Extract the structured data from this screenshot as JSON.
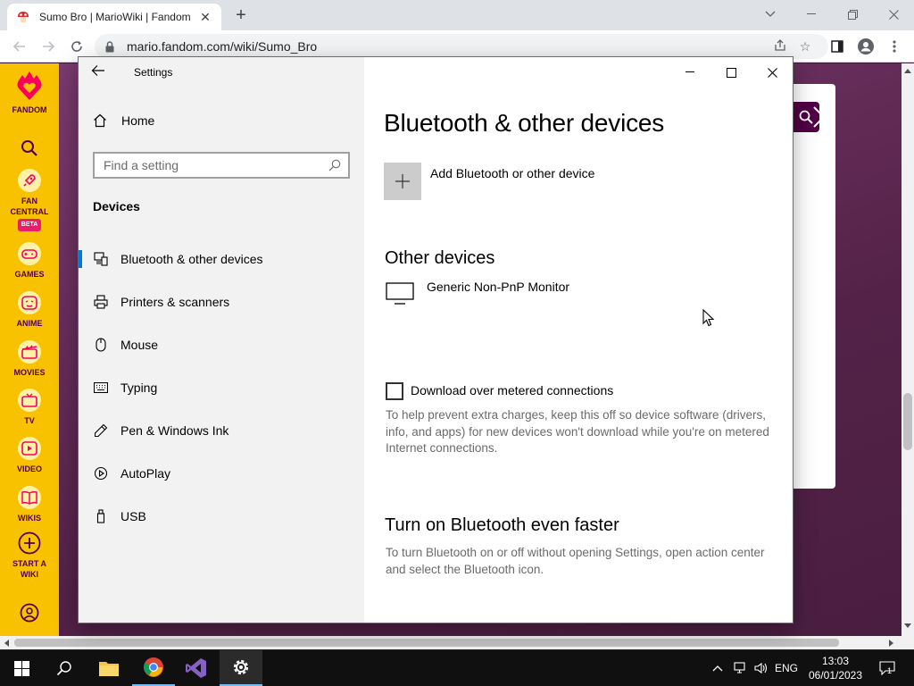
{
  "browser": {
    "tab_title": "Sumo Bro | MarioWiki | Fandom",
    "url": "mario.fandom.com/wiki/Sumo_Bro"
  },
  "fandom_rail": {
    "logo_label": "FANDOM",
    "items": [
      {
        "label_line1": "FAN",
        "label_line2": "CENTRAL",
        "badge": "BETA",
        "icon": "rocket-icon"
      },
      {
        "label_line1": "GAMES",
        "icon": "controller-icon"
      },
      {
        "label_line1": "ANIME",
        "icon": "anime-face-icon"
      },
      {
        "label_line1": "MOVIES",
        "icon": "clapperboard-icon"
      },
      {
        "label_line1": "TV",
        "icon": "tv-icon"
      },
      {
        "label_line1": "VIDEO",
        "icon": "play-icon"
      },
      {
        "label_line1": "WIKIS",
        "icon": "book-icon"
      },
      {
        "label_line1": "START A",
        "label_line2": "WIKI",
        "icon": "plus-circle-icon"
      }
    ]
  },
  "settings": {
    "app_title": "Settings",
    "home_label": "Home",
    "search_placeholder": "Find a setting",
    "section_label": "Devices",
    "nav": [
      {
        "label": "Bluetooth & other devices",
        "icon": "bluetooth-devices-icon",
        "active": true
      },
      {
        "label": "Printers & scanners",
        "icon": "printer-icon"
      },
      {
        "label": "Mouse",
        "icon": "mouse-icon"
      },
      {
        "label": "Typing",
        "icon": "keyboard-icon"
      },
      {
        "label": "Pen & Windows Ink",
        "icon": "pen-icon"
      },
      {
        "label": "AutoPlay",
        "icon": "autoplay-icon"
      },
      {
        "label": "USB",
        "icon": "usb-icon"
      }
    ],
    "page_title": "Bluetooth & other devices",
    "add_device_label": "Add Bluetooth or other device",
    "other_devices_heading": "Other devices",
    "device_name": "Generic Non-PnP Monitor",
    "metered_label": "Download over metered connections",
    "metered_checked": false,
    "metered_help": "To help prevent extra charges, keep this off so device software (drivers, info, and apps) for new devices won't download while you're on metered Internet connections.",
    "bt_faster_heading": "Turn on Bluetooth even faster",
    "bt_faster_help": "To turn Bluetooth on or off without opening Settings, open action center and select the Bluetooth icon."
  },
  "taskbar": {
    "language": "ENG",
    "time": "13:03",
    "date": "06/01/2023",
    "notification_count": "1"
  },
  "colors": {
    "accent": "#0078d7",
    "fandom_yellow": "#f8c200",
    "fandom_purple": "#520044"
  }
}
